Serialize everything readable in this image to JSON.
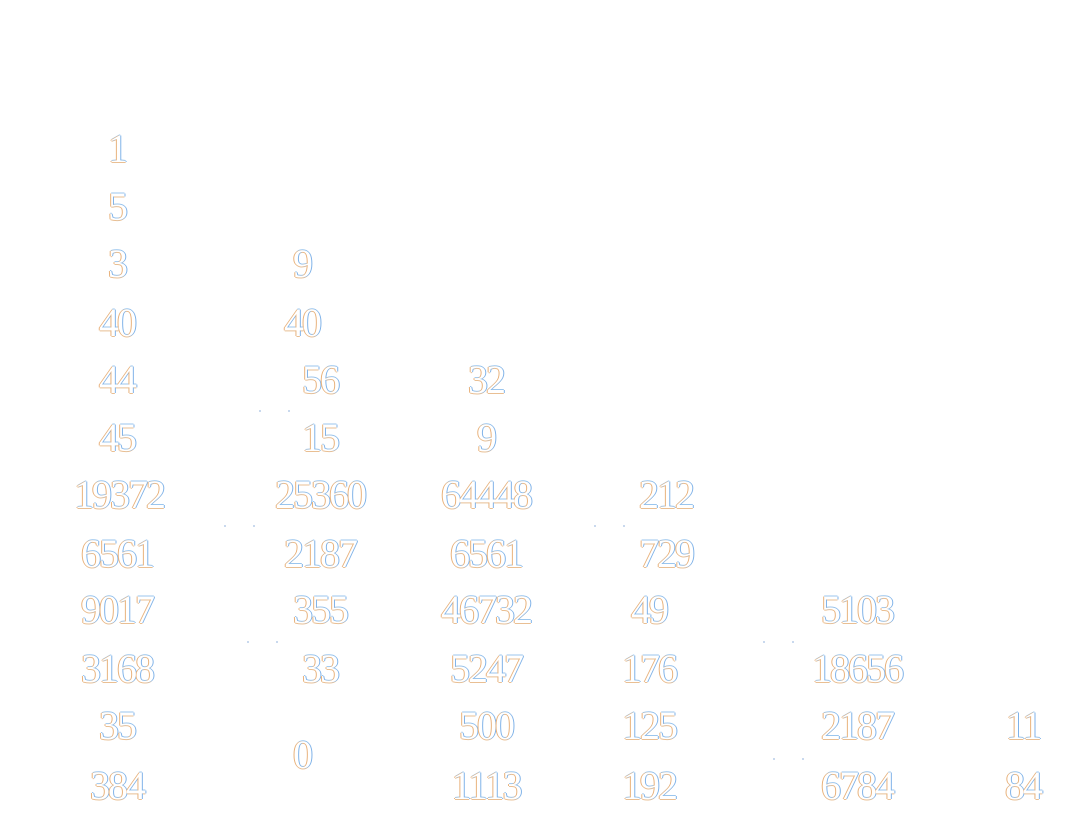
{
  "columns": [
    [
      "1",
      "5",
      "3",
      "40",
      "44",
      "45",
      "19372",
      "6561",
      "9017",
      "3168",
      "35",
      "384"
    ],
    [
      "9",
      "40",
      "56",
      "15",
      "25360",
      "2187",
      "355",
      "33",
      "0"
    ],
    [
      "32",
      "9",
      "64448",
      "6561",
      "46732",
      "5247",
      "500",
      "1113"
    ],
    [
      "212",
      "729",
      "49",
      "176",
      "125",
      "192"
    ],
    [
      "5103",
      "18656",
      "2187",
      "6784"
    ],
    [
      "11",
      "84"
    ]
  ]
}
